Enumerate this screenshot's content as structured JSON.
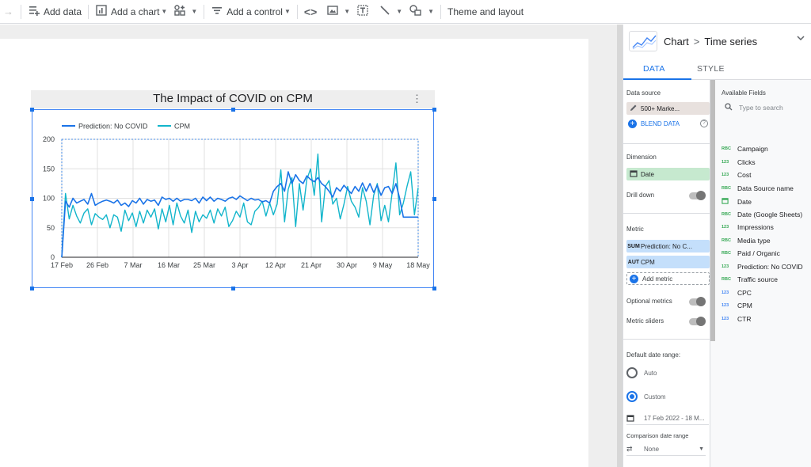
{
  "toolbar": {
    "add_data": "Add data",
    "add_chart": "Add a chart",
    "add_control": "Add a control",
    "theme": "Theme and layout"
  },
  "chart": {
    "title": "The Impact of COVID on CPM"
  },
  "chart_data": {
    "type": "line",
    "x": [
      "17 Feb",
      "26 Feb",
      "7 Mar",
      "16 Mar",
      "25 Mar",
      "3 Apr",
      "12 Apr",
      "21 Apr",
      "30 Apr",
      "9 May",
      "18 May"
    ],
    "ylim": [
      0,
      200
    ],
    "yticks": [
      0,
      50,
      100,
      150,
      200
    ],
    "legend_position": "top-left",
    "grid": true,
    "series": [
      {
        "name": "Prediction: No COVID",
        "color": "#1a73e8",
        "values": [
          0,
          95,
          85,
          100,
          92,
          95,
          98,
          90,
          108,
          88,
          92,
          95,
          97,
          95,
          92,
          97,
          88,
          92,
          86,
          96,
          92,
          100,
          90,
          98,
          95,
          97,
          88,
          102,
          98,
          100,
          95,
          100,
          95,
          98,
          98,
          96,
          100,
          92,
          102,
          96,
          102,
          95,
          100,
          98,
          95,
          100,
          102,
          98,
          104,
          100,
          96,
          100,
          97,
          98,
          94,
          96,
          92,
          112,
          120,
          125,
          112,
          145,
          125,
          140,
          130,
          125,
          138,
          132,
          128,
          135,
          125,
          120,
          112,
          102,
          118,
          112,
          122,
          115,
          108,
          120,
          112,
          126,
          112,
          125,
          110,
          122,
          105,
          118,
          120,
          108,
          125,
          100,
          68,
          68,
          68,
          68,
          68
        ]
      },
      {
        "name": "CPM",
        "color": "#12b5cb",
        "values": [
          0,
          108,
          65,
          88,
          70,
          58,
          75,
          82,
          55,
          74,
          68,
          64,
          72,
          50,
          72,
          68,
          44,
          80,
          62,
          75,
          52,
          78,
          58,
          80,
          68,
          82,
          48,
          82,
          60,
          88,
          55,
          92,
          70,
          58,
          80,
          42,
          78,
          60,
          72,
          66,
          80,
          58,
          82,
          70,
          85,
          52,
          62,
          78,
          68,
          92,
          60,
          55,
          78,
          84,
          95,
          70,
          92,
          72,
          90,
          148,
          60,
          115,
          135,
          52,
          125,
          80,
          132,
          150,
          105,
          175,
          60,
          120,
          130,
          90,
          100,
          65,
          90,
          120,
          95,
          85,
          68,
          118,
          95,
          55,
          105,
          125,
          62,
          88,
          60,
          110,
          160,
          72,
          92,
          120,
          145,
          72,
          118
        ]
      }
    ]
  },
  "panel": {
    "breadcrumb_1": "Chart",
    "breadcrumb_2": "Time series",
    "tab_data": "DATA",
    "tab_style": "STYLE",
    "data_source_label": "Data source",
    "data_source_value": "500+ Marke...",
    "blend_data": "BLEND DATA",
    "dimension_label": "Dimension",
    "dimension_value": "Date",
    "drill_down": "Drill down",
    "metric_label": "Metric",
    "metric_1_agg": "SUM",
    "metric_1": "Prediction: No C...",
    "metric_2_agg": "AUT",
    "metric_2": "CPM",
    "add_metric": "Add metric",
    "optional_metrics": "Optional metrics",
    "metric_sliders": "Metric sliders",
    "default_date_range": "Default date range:",
    "auto": "Auto",
    "custom": "Custom",
    "date_range_value": "17 Feb 2022 - 18 M...",
    "comparison_date_range": "Comparison date range",
    "comparison_value": "None"
  },
  "fields": {
    "title": "Available Fields",
    "search_placeholder": "Type to search",
    "items": [
      {
        "type": "ABC",
        "name": "Campaign"
      },
      {
        "type": "123",
        "name": "Clicks"
      },
      {
        "type": "123",
        "name": "Cost"
      },
      {
        "type": "ABC",
        "name": "Data Source name"
      },
      {
        "type": "CAL",
        "name": "Date"
      },
      {
        "type": "ABC",
        "name": "Date (Google Sheets)"
      },
      {
        "type": "123",
        "name": "Impressions"
      },
      {
        "type": "ABC",
        "name": "Media type"
      },
      {
        "type": "ABC",
        "name": "Paid / Organic"
      },
      {
        "type": "123",
        "name": "Prediction: No COVID"
      },
      {
        "type": "ABC",
        "name": "Traffic source"
      },
      {
        "type": "123b",
        "name": "CPC"
      },
      {
        "type": "123b",
        "name": "CPM"
      },
      {
        "type": "123b",
        "name": "CTR"
      }
    ]
  }
}
